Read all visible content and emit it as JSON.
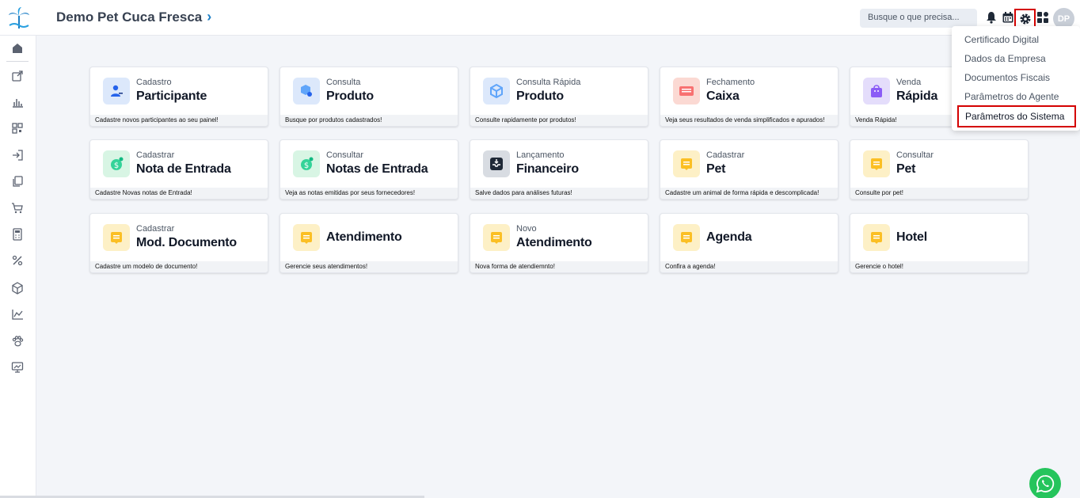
{
  "header": {
    "company_name": "Demo Pet Cuca Fresca",
    "search_placeholder": "Busque o que precisa...",
    "avatar_initials": "DP"
  },
  "sidebar": {
    "icons": [
      "home-icon",
      "share-icon",
      "bar-chart-icon",
      "qr-code-icon",
      "login-icon",
      "copy-icon",
      "cart-icon",
      "calculator-icon",
      "percent-icon",
      "box-icon",
      "line-chart-icon",
      "paw-icon",
      "presentation-icon"
    ]
  },
  "cards": [
    {
      "sub": "Cadastro",
      "title": "Participante",
      "foot": "Cadastre novos participantes ao seu painel!",
      "color": "blue",
      "icon": "user-plus-icon"
    },
    {
      "sub": "Consulta",
      "title": "Produto",
      "foot": "Busque por produtos cadastrados!",
      "color": "blue",
      "icon": "product-search-icon"
    },
    {
      "sub": "Consulta Rápida",
      "title": "Produto",
      "foot": "Consulte rapidamente por produtos!",
      "color": "blue",
      "icon": "product-quick-icon"
    },
    {
      "sub": "Fechamento",
      "title": "Caixa",
      "foot": "Veja seus resultados de venda simplificados e apurados!",
      "color": "red",
      "icon": "cash-register-icon"
    },
    {
      "sub": "Venda",
      "title": "Rápida",
      "foot": "Venda Rápida!",
      "color": "purple",
      "icon": "shopping-bag-icon"
    },
    {
      "sub": "Cadastrar",
      "title": "Nota de Entrada",
      "foot": "Cadastre Novas notas de Entrada!",
      "color": "green",
      "icon": "money-add-icon"
    },
    {
      "sub": "Consultar",
      "title": "Notas de Entrada",
      "foot": "Veja as notas emitidas por seus fornecedores!",
      "color": "green",
      "icon": "money-search-icon"
    },
    {
      "sub": "Lançamento",
      "title": "Financeiro",
      "foot": "Salve dados para análises futuras!",
      "color": "gray",
      "icon": "finance-inbox-icon"
    },
    {
      "sub": "Cadastrar",
      "title": "Pet",
      "foot": "Cadastre um animal de forma rápida e descomplicada!",
      "color": "yellow",
      "icon": "note-icon"
    },
    {
      "sub": "Consultar",
      "title": "Pet",
      "foot": "Consulte por pet!",
      "color": "yellow",
      "icon": "note-icon"
    },
    {
      "sub": "Cadastrar",
      "title": "Mod. Documento",
      "foot": "Cadastre um modelo de documento!",
      "color": "yellow",
      "icon": "note-icon"
    },
    {
      "sub": "",
      "title": "Atendimento",
      "foot": "Gerencie seus atendimentos!",
      "color": "yellow",
      "icon": "note-icon"
    },
    {
      "sub": "Novo",
      "title": "Atendimento",
      "foot": "Nova forma de atendiemnto!",
      "color": "yellow",
      "icon": "note-icon"
    },
    {
      "sub": "",
      "title": "Agenda",
      "foot": "Confira a agenda!",
      "color": "yellow",
      "icon": "note-icon"
    },
    {
      "sub": "",
      "title": "Hotel",
      "foot": "Gerencie o hotel!",
      "color": "yellow",
      "icon": "note-icon"
    }
  ],
  "dropdown": {
    "items": [
      "Certificado Digital",
      "Dados da Empresa",
      "Documentos Fiscais",
      "Parâmetros do Agente"
    ],
    "active_item": "Parâmetros do Sistema"
  }
}
